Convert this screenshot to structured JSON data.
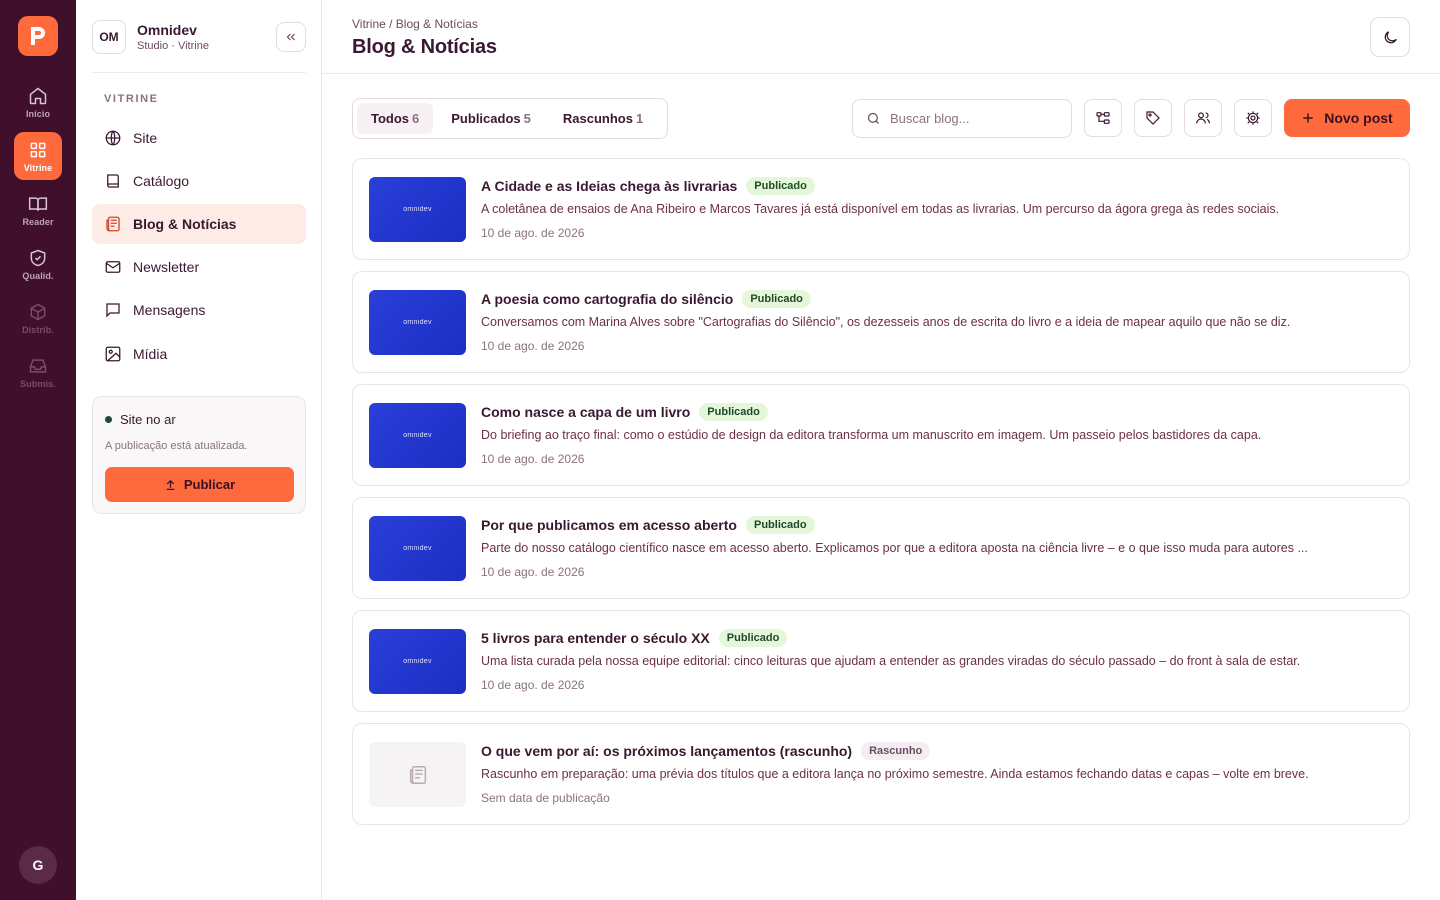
{
  "rail": {
    "items": [
      {
        "label": "Início"
      },
      {
        "label": "Vitrine"
      },
      {
        "label": "Reader"
      },
      {
        "label": "Qualid."
      },
      {
        "label": "Distrib."
      },
      {
        "label": "Submis."
      }
    ],
    "avatar": "G",
    "accent": "#ff6a3d",
    "bg": "#3f0f2b"
  },
  "workspace": {
    "badge": "OM",
    "name": "Omnidev",
    "subtitle": "Studio · Vitrine"
  },
  "sidebar": {
    "section": "VITRINE",
    "items": [
      {
        "label": "Site",
        "icon": "globe-icon"
      },
      {
        "label": "Catálogo",
        "icon": "book-icon"
      },
      {
        "label": "Blog & Notícias",
        "icon": "newspaper-icon"
      },
      {
        "label": "Newsletter",
        "icon": "mail-icon"
      },
      {
        "label": "Mensagens",
        "icon": "message-icon"
      },
      {
        "label": "Mídia",
        "icon": "image-icon"
      }
    ],
    "status": {
      "title": "Site no ar",
      "subtitle": "A publicação está atualizada.",
      "button": "Publicar"
    }
  },
  "header": {
    "breadcrumb": "Vitrine / Blog & Notícias",
    "title": "Blog & Notícias"
  },
  "tabs": [
    {
      "label": "Todos",
      "count": "6"
    },
    {
      "label": "Publicados",
      "count": "5"
    },
    {
      "label": "Rascunhos",
      "count": "1"
    }
  ],
  "search": {
    "placeholder": "Buscar blog..."
  },
  "new_post_label": "Novo post",
  "thumb_word": "omnidev",
  "posts": [
    {
      "title": "A Cidade e as Ideias chega às livrarias",
      "status": "Publicado",
      "description": "A coletânea de ensaios de Ana Ribeiro e Marcos Tavares já está disponível em todas as livrarias. Um percurso da ágora grega às redes sociais.",
      "date": "10 de ago. de 2026"
    },
    {
      "title": "A poesia como cartografia do silêncio",
      "status": "Publicado",
      "description": "Conversamos com Marina Alves sobre \"Cartografias do Silêncio\", os dezesseis anos de escrita do livro e a ideia de mapear aquilo que não se diz.",
      "date": "10 de ago. de 2026"
    },
    {
      "title": "Como nasce a capa de um livro",
      "status": "Publicado",
      "description": "Do briefing ao traço final: como o estúdio de design da editora transforma um manuscrito em imagem. Um passeio pelos bastidores da capa.",
      "date": "10 de ago. de 2026"
    },
    {
      "title": "Por que publicamos em acesso aberto",
      "status": "Publicado",
      "description": "Parte do nosso catálogo científico nasce em acesso aberto. Explicamos por que a editora aposta na ciência livre – e o que isso muda para autores ...",
      "date": "10 de ago. de 2026"
    },
    {
      "title": "5 livros para entender o século XX",
      "status": "Publicado",
      "description": "Uma lista curada pela nossa equipe editorial: cinco leituras que ajudam a entender as grandes viradas do século passado – do front à sala de estar.",
      "date": "10 de ago. de 2026"
    },
    {
      "title": "O que vem por aí: os próximos lançamentos (rascunho)",
      "status": "Rascunho",
      "description": "Rascunho em preparação: uma prévia dos títulos que a editora lança no próximo semestre. Ainda estamos fechando datas e capas – volte em breve.",
      "date": "Sem data de publicação"
    }
  ]
}
